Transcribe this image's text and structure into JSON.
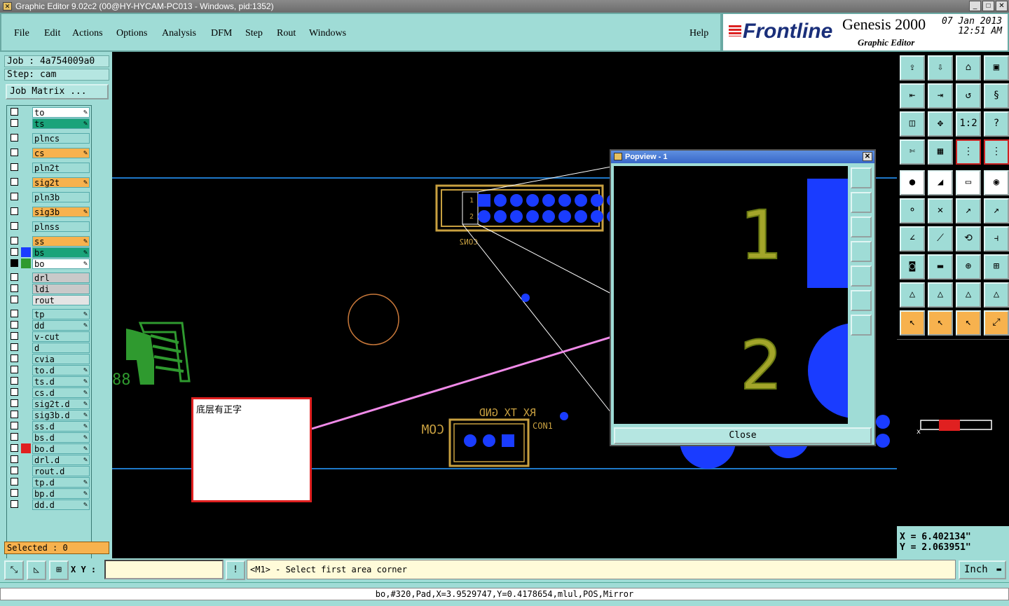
{
  "window": {
    "title": "Graphic Editor 9.02c2 (00@HY-HYCAM-PC013 - Windows, pid:1352)"
  },
  "menu": [
    {
      "label": "File"
    },
    {
      "label": "Edit"
    },
    {
      "label": "Actions"
    },
    {
      "label": "Options"
    },
    {
      "label": "Analysis"
    },
    {
      "label": "DFM"
    },
    {
      "label": "Step"
    },
    {
      "label": "Rout"
    },
    {
      "label": "Windows"
    }
  ],
  "help_label": "Help",
  "logo": {
    "brand": "Frontline",
    "product": "Genesis 2000",
    "subtitle": "Graphic Editor",
    "date": "07 Jan 2013",
    "time": "12:51 AM"
  },
  "job": {
    "job_label": "Job : 4a754009a0",
    "step_label": "Step: cam",
    "matrix_button": "Job Matrix ..."
  },
  "layers": [
    {
      "name": "to",
      "color": "#ffffff",
      "editable": true
    },
    {
      "name": "ts",
      "color": "#1aa37a",
      "editable": true
    },
    {
      "name": "plncs",
      "color": "#9fdcd6",
      "editable": false
    },
    {
      "name": "cs",
      "color": "#f7b24e",
      "editable": true
    },
    {
      "name": "pln2t",
      "color": "#9fdcd6",
      "editable": false
    },
    {
      "name": "sig2t",
      "color": "#f7b24e",
      "editable": true
    },
    {
      "name": "pln3b",
      "color": "#9fdcd6",
      "editable": false
    },
    {
      "name": "sig3b",
      "color": "#f7b24e",
      "editable": true
    },
    {
      "name": "plnss",
      "color": "#9fdcd6",
      "editable": false
    },
    {
      "name": "ss",
      "color": "#f7b24e",
      "editable": true
    },
    {
      "name": "bs",
      "color": "#1aa37a",
      "editable": true,
      "swatch": "#1a3cff"
    },
    {
      "name": "bo",
      "color": "#ffffff",
      "editable": true,
      "swatch": "#2f9a2f",
      "selected": true
    },
    {
      "name": "drl",
      "color": "#c9c9c9",
      "editable": false
    },
    {
      "name": "ldi",
      "color": "#c9c9c9",
      "editable": false
    },
    {
      "name": "rout",
      "color": "#e4e4e4",
      "editable": false
    },
    {
      "name": "tp",
      "color": "#9fdcd6",
      "editable": true
    },
    {
      "name": "dd",
      "color": "#9fdcd6",
      "editable": true
    },
    {
      "name": "v-cut",
      "color": "#9fdcd6",
      "editable": false
    },
    {
      "name": "d",
      "color": "#9fdcd6",
      "editable": false
    },
    {
      "name": "cvia",
      "color": "#9fdcd6",
      "editable": false
    },
    {
      "name": "to.d",
      "color": "#9fdcd6",
      "editable": true
    },
    {
      "name": "ts.d",
      "color": "#9fdcd6",
      "editable": true
    },
    {
      "name": "cs.d",
      "color": "#9fdcd6",
      "editable": true
    },
    {
      "name": "sig2t.d",
      "color": "#9fdcd6",
      "editable": true
    },
    {
      "name": "sig3b.d",
      "color": "#9fdcd6",
      "editable": true
    },
    {
      "name": "ss.d",
      "color": "#9fdcd6",
      "editable": true
    },
    {
      "name": "bs.d",
      "color": "#9fdcd6",
      "editable": true
    },
    {
      "name": "bo.d",
      "color": "#9fdcd6",
      "editable": true,
      "swatch": "#e02020"
    },
    {
      "name": "drl.d",
      "color": "#9fdcd6",
      "editable": true
    },
    {
      "name": "rout.d",
      "color": "#9fdcd6",
      "editable": false
    },
    {
      "name": "tp.d",
      "color": "#9fdcd6",
      "editable": true
    },
    {
      "name": "bp.d",
      "color": "#9fdcd6",
      "editable": true
    },
    {
      "name": "dd.d",
      "color": "#9fdcd6",
      "editable": true
    }
  ],
  "selected_label": "Selected : 0",
  "canvas": {
    "ref_con2": "CON2",
    "pin1": "1",
    "pin2": "2",
    "com_text": "COM",
    "rx_tx_gnd": "RX TX GND",
    "con1_text": "CON1",
    "note_text": "底层有正字"
  },
  "popview": {
    "title": "Popview - 1",
    "close_label": "Close",
    "digit1": "1",
    "digit2": "2"
  },
  "coords": {
    "x": "X = 6.402134\"",
    "y": "Y = 2.063951\""
  },
  "bottom": {
    "xy_label": "X Y :",
    "xy_value": "",
    "prompt": "<M1> - Select first area corner",
    "unit": "Inch"
  },
  "status": "bo,#320,Pad,X=3.9529747,Y=0.4178654,mlul,POS,Mirror",
  "colors": {
    "panel": "#9fdcd6",
    "accent_orange": "#f7b24e",
    "pad_blue": "#1a3cff",
    "outline_gold": "#c8a040"
  }
}
